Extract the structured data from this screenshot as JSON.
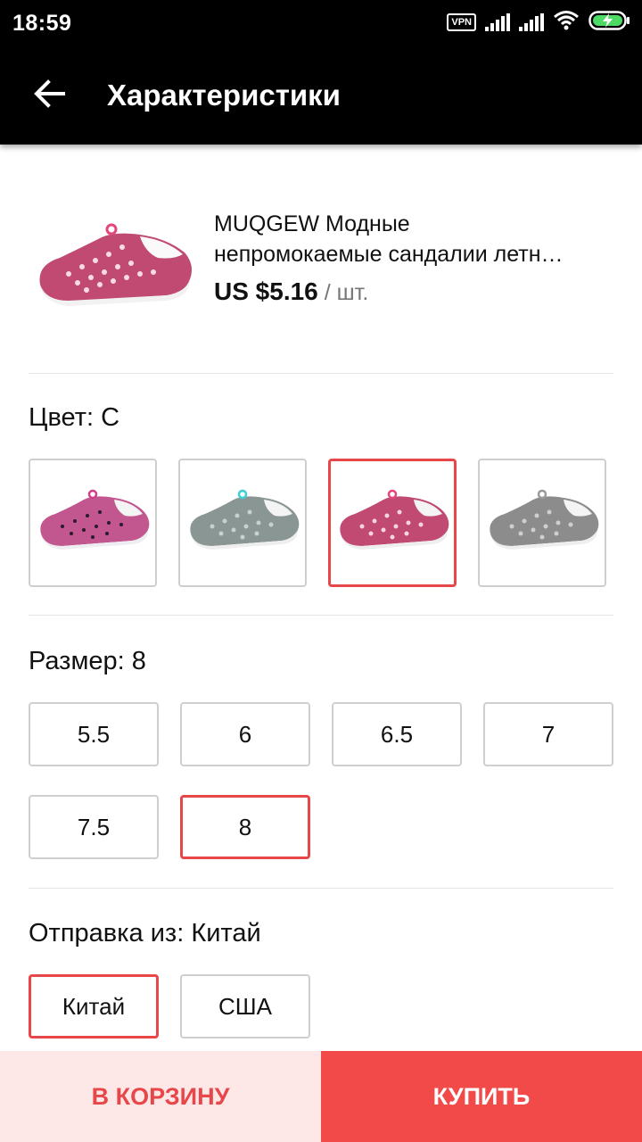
{
  "status_bar": {
    "time": "18:59",
    "vpn_label": "VPN",
    "icons": [
      "vpn-icon",
      "signal-icon",
      "signal-icon",
      "wifi-icon",
      "battery-charging-icon"
    ]
  },
  "app_bar": {
    "back_icon": "arrow-left-icon",
    "title": "Характеристики"
  },
  "product": {
    "name_line1": "MUQGEW Модные",
    "name_line2": "непромокаемые сандалии летн…",
    "price": "US $5.16",
    "unit": " / шт."
  },
  "color": {
    "title": "Цвет: C",
    "options": [
      {
        "name": "pink-speckled",
        "color": "#c2568e",
        "selected": false
      },
      {
        "name": "gray-teal",
        "color": "#8a9694",
        "selected": false
      },
      {
        "name": "rose-pink",
        "color": "#c04a72",
        "selected": true
      },
      {
        "name": "gray",
        "color": "#8c8c8c",
        "selected": false
      }
    ]
  },
  "size": {
    "title": "Размер: 8",
    "options": [
      "5.5",
      "6",
      "6.5",
      "7",
      "7.5",
      "8"
    ],
    "selected": "8"
  },
  "ship_from": {
    "title": "Отправка из: Китай",
    "options": [
      "Китай",
      "США"
    ],
    "selected": "Китай"
  },
  "actions": {
    "cart_label": "В КОРЗИНУ",
    "buy_label": "КУПИТЬ"
  },
  "colors": {
    "accent": "#e8474a",
    "cart_bg": "#fde7e7",
    "buy_bg": "#f24a49"
  }
}
